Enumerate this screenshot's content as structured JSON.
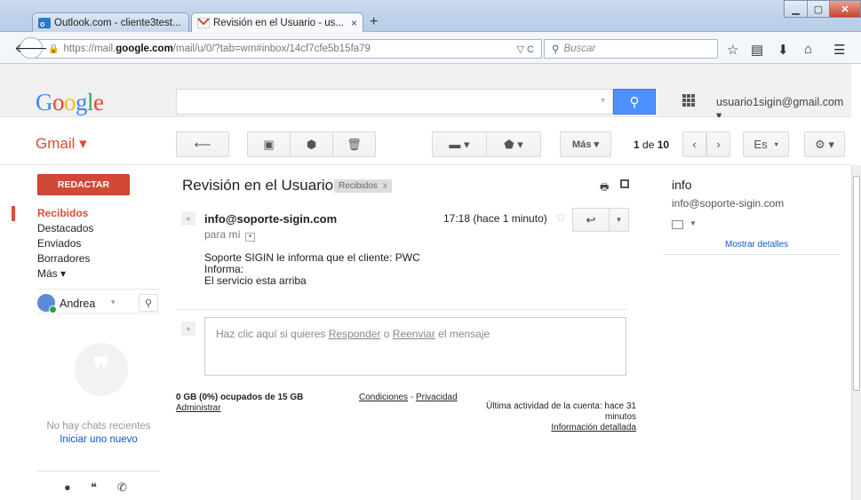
{
  "browser": {
    "tabs": [
      {
        "label": "Outlook.com - cliente3test...",
        "active": false
      },
      {
        "label": "Revisión en el Usuario - us...",
        "active": true
      }
    ],
    "tab_close": "×",
    "new_tab": "+",
    "url_prefix": "https://mail.",
    "url_domain": "google.com",
    "url_path": "/mail/u/0/?tab=wm#inbox/14cf7cfe5b15fa79",
    "url_controls": "▽ C",
    "search_placeholder": "Buscar"
  },
  "gmail": {
    "logo": "Google",
    "account": "usuario1sigin@gmail.com ▾",
    "app_label": "Gmail ▾",
    "toolbar": {
      "more": "Más ▾",
      "pager_current": "1",
      "pager_sep": " de ",
      "pager_total": "10",
      "lang": "Es"
    },
    "compose": "REDACTAR",
    "nav": [
      "Recibidos",
      "Destacados",
      "Enviados",
      "Borradores",
      "Más ▾"
    ],
    "chat": {
      "user": "Andrea",
      "empty": "No hay chats recientes",
      "start": "Iniciar uno nuevo"
    }
  },
  "message": {
    "subject": "Revisión en el Usuario",
    "label": "Recibidos",
    "label_close": "x",
    "sender": "info@soporte-sigin.com",
    "to": "para mí",
    "time": "17:18 (hace 1 minuto)",
    "body_lines": [
      "Soporte SIGIN le informa que el cliente:  PWC",
      "Informa:",
      "El servicio esta arriba"
    ],
    "reply_prefix": "Haz clic aquí si quieres ",
    "reply_link": "Responder",
    "reply_mid": " o ",
    "forward_link": "Reenviar",
    "reply_suffix": " el mensaje"
  },
  "footer": {
    "storage": "0 GB (0%) ocupados de 15 GB",
    "manage": "Administrar",
    "terms": "Condiciones",
    "terms_sep": " - ",
    "privacy": "Privacidad",
    "activity_line1": "Última actividad de la cuenta: hace 31",
    "activity_line2": "minutos",
    "details": "Información detallada"
  },
  "contact": {
    "name": "info",
    "email": "info@soporte-sigin.com",
    "show_details": "Mostrar detalles"
  },
  "colors": {
    "gmail_red": "#dd4b39",
    "compose_red": "#d14836",
    "search_blue": "#4d90fe",
    "link_blue": "#1155cc"
  }
}
